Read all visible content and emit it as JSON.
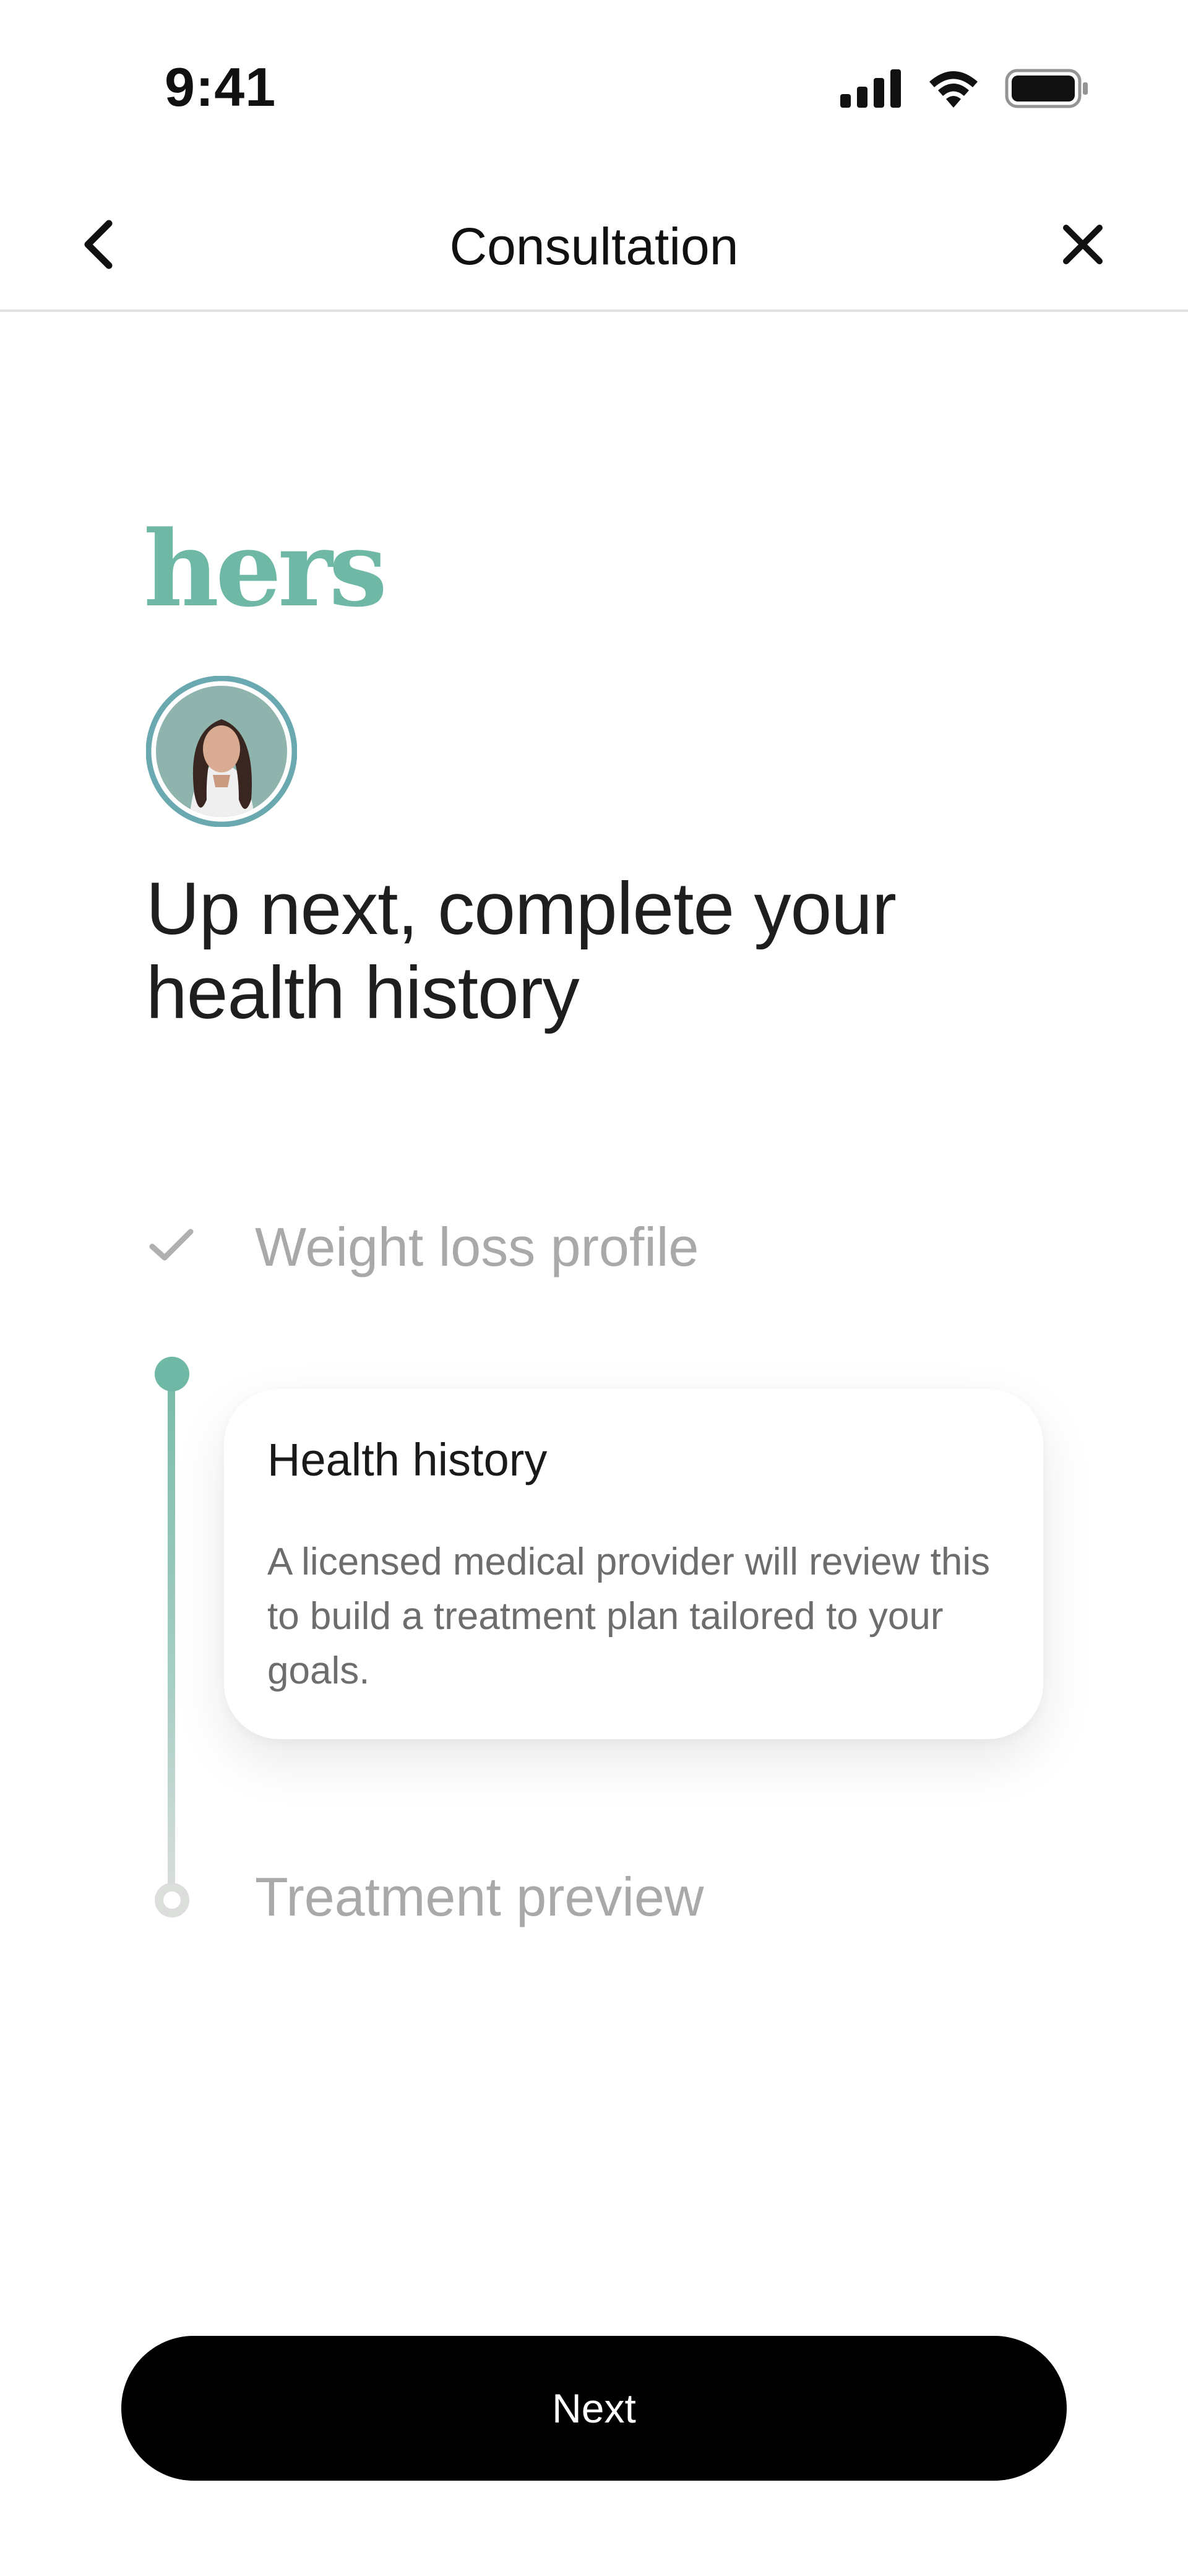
{
  "status_bar": {
    "time": "9:41",
    "icons": [
      "signal-icon",
      "wifi-icon",
      "battery-icon"
    ]
  },
  "nav": {
    "title": "Consultation",
    "back_icon": "chevron-left-icon",
    "close_icon": "close-icon"
  },
  "brand": {
    "logo_text": "hers",
    "color": "#6fb8a6"
  },
  "provider_avatar": "avatar-photo",
  "heading": "Up next, complete your health history",
  "steps": [
    {
      "label": "Weight loss profile",
      "state": "complete",
      "icon": "check-icon"
    },
    {
      "label": "Health history",
      "state": "current",
      "description": "A licensed medical provider will review this to build a treatment plan tailored to your goals."
    },
    {
      "label": "Treatment preview",
      "state": "pending"
    }
  ],
  "cta": {
    "label": "Next"
  },
  "colors": {
    "accent": "#6fb8a6",
    "muted_text": "#a9a9a9",
    "button_bg": "#000000",
    "button_text": "#ffffff"
  }
}
